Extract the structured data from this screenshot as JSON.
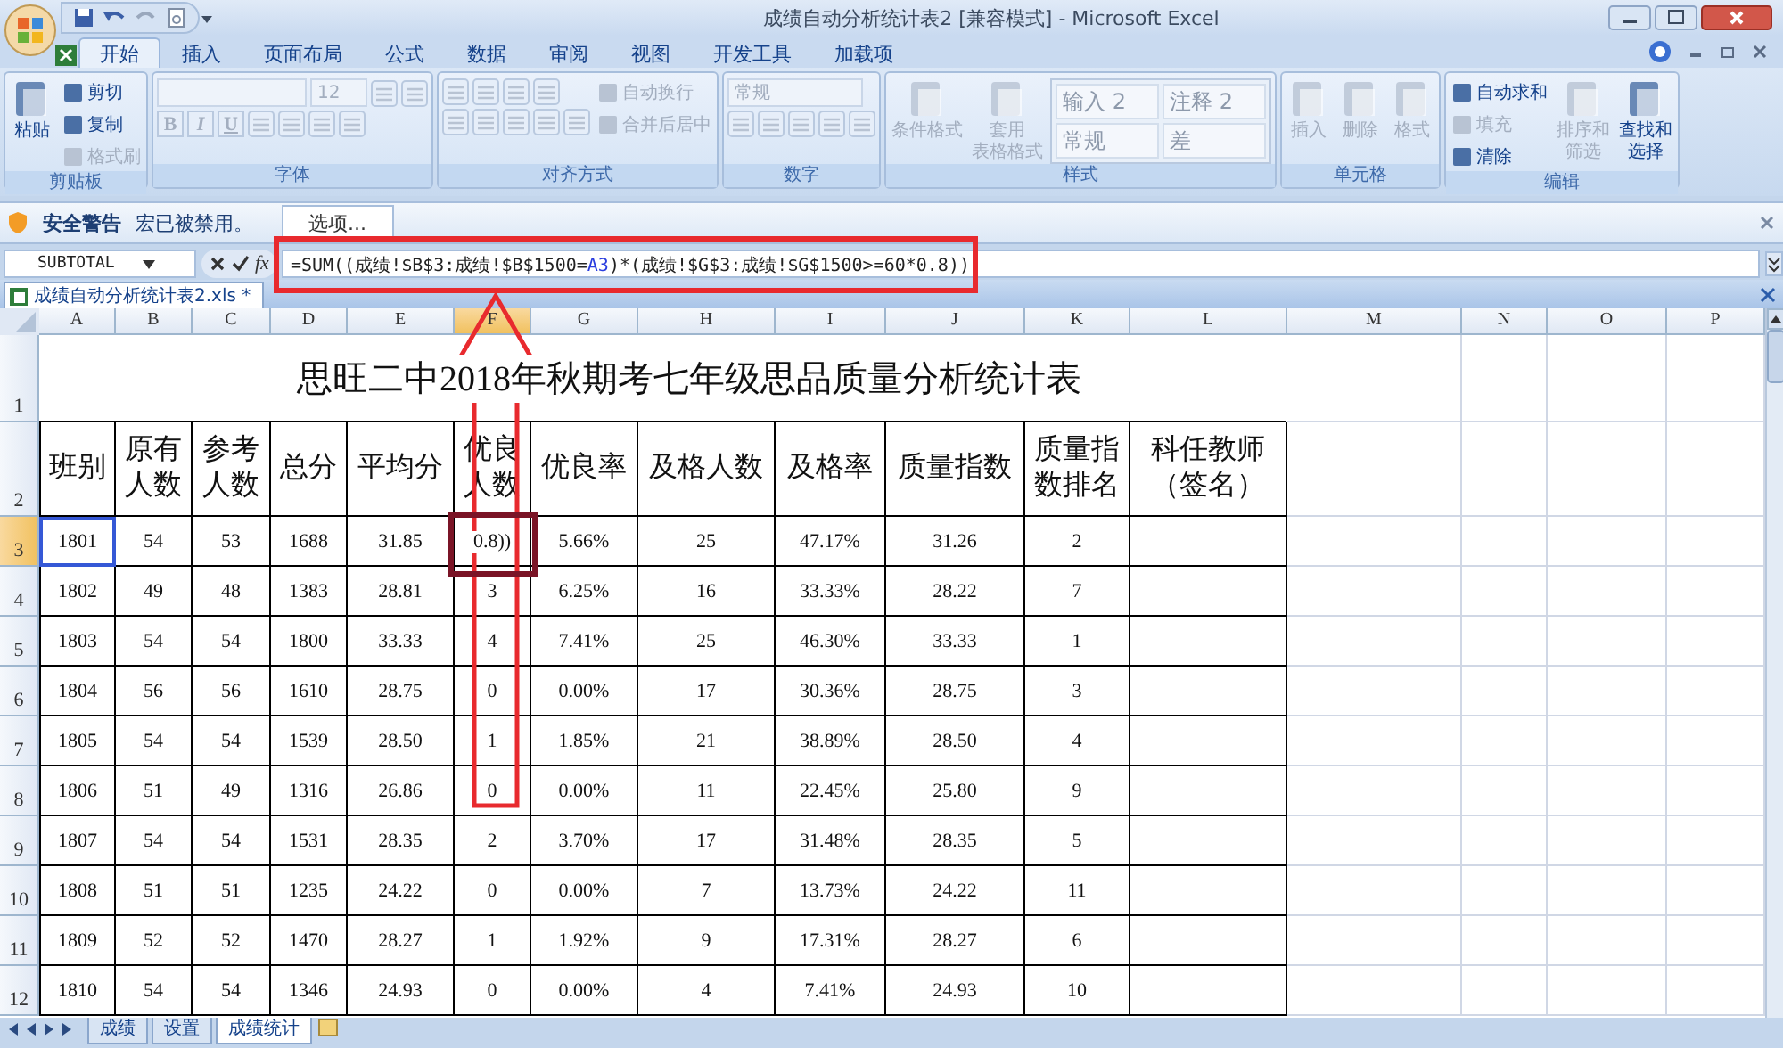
{
  "window": {
    "title": "成绩自动分析统计表2  [兼容模式] - Microsoft Excel"
  },
  "ribbon": {
    "tabs": [
      {
        "label": "开始",
        "selected": true
      },
      {
        "label": "插入",
        "selected": false
      },
      {
        "label": "页面布局",
        "selected": false
      },
      {
        "label": "公式",
        "selected": false
      },
      {
        "label": "数据",
        "selected": false
      },
      {
        "label": "审阅",
        "selected": false
      },
      {
        "label": "视图",
        "selected": false
      },
      {
        "label": "开发工具",
        "selected": false
      },
      {
        "label": "加载项",
        "selected": false
      }
    ],
    "groups": [
      {
        "label": "剪贴板",
        "columns": [
          [
            {
              "kind": "large",
              "label": "粘贴",
              "disabled": false
            }
          ],
          [
            {
              "kind": "small",
              "label": "剪切",
              "disabled": false
            },
            {
              "kind": "small",
              "label": "复制",
              "disabled": false
            },
            {
              "kind": "small",
              "label": "格式刷",
              "disabled": true
            }
          ]
        ]
      },
      {
        "label": "字体",
        "columns": [
          [
            {
              "kind": "toolrow",
              "items": [
                {
                  "kind": "wide_field",
                  "disabled": true
                },
                {
                  "kind": "field",
                  "value": "12",
                  "disabled": true
                },
                {
                  "kind": "icon",
                  "disabled": true
                },
                {
                  "kind": "icon",
                  "disabled": true
                }
              ]
            },
            {
              "kind": "toolrow",
              "items": [
                {
                  "kind": "glyph",
                  "label": "B",
                  "disabled": true
                },
                {
                  "kind": "glyph",
                  "label": "I",
                  "disabled": true
                },
                {
                  "kind": "glyph",
                  "label": "U",
                  "disabled": true
                },
                {
                  "kind": "icon",
                  "disabled": true
                },
                {
                  "kind": "icon",
                  "disabled": true
                },
                {
                  "kind": "icon",
                  "disabled": true
                },
                {
                  "kind": "icon",
                  "disabled": true
                }
              ]
            }
          ]
        ]
      },
      {
        "label": "对齐方式",
        "columns": [
          [
            {
              "kind": "toolrow",
              "items": [
                {
                  "kind": "icon",
                  "disabled": true
                },
                {
                  "kind": "icon",
                  "disabled": true
                },
                {
                  "kind": "icon",
                  "disabled": true
                },
                {
                  "kind": "icon",
                  "disabled": true
                }
              ]
            },
            {
              "kind": "toolrow",
              "items": [
                {
                  "kind": "icon",
                  "disabled": true
                },
                {
                  "kind": "icon",
                  "disabled": true
                },
                {
                  "kind": "icon",
                  "disabled": true
                },
                {
                  "kind": "icon",
                  "disabled": true
                },
                {
                  "kind": "icon",
                  "disabled": true
                }
              ]
            }
          ],
          [
            {
              "kind": "small",
              "label": "自动换行",
              "disabled": true
            },
            {
              "kind": "small",
              "label": "合并后居中",
              "disabled": true
            }
          ]
        ]
      },
      {
        "label": "数字",
        "columns": [
          [
            {
              "kind": "wide_field",
              "value": "常规",
              "disabled": true
            },
            {
              "kind": "toolrow",
              "items": [
                {
                  "kind": "icon",
                  "disabled": true
                },
                {
                  "kind": "icon",
                  "disabled": true
                },
                {
                  "kind": "icon",
                  "disabled": true
                },
                {
                  "kind": "icon",
                  "disabled": true
                },
                {
                  "kind": "icon",
                  "disabled": true
                }
              ]
            }
          ]
        ]
      },
      {
        "label": "样式",
        "columns": [
          [
            {
              "kind": "large",
              "label": "条件格式",
              "disabled": true
            }
          ],
          [
            {
              "kind": "large",
              "lines": [
                "套用",
                "表格格式"
              ],
              "disabled": true
            }
          ],
          [
            {
              "kind": "gallery",
              "cells": [
                "输入 2",
                "注释 2",
                "常规",
                "差"
              ],
              "disabled": true
            }
          ]
        ]
      },
      {
        "label": "单元格",
        "columns": [
          [
            {
              "kind": "large",
              "label": "插入",
              "disabled": true
            }
          ],
          [
            {
              "kind": "large",
              "label": "删除",
              "disabled": true
            }
          ],
          [
            {
              "kind": "large",
              "label": "格式",
              "disabled": true
            }
          ]
        ]
      },
      {
        "label": "编辑",
        "columns": [
          [
            {
              "kind": "small",
              "label": "自动求和",
              "disabled": false
            },
            {
              "kind": "small",
              "label": "填充",
              "disabled": true
            },
            {
              "kind": "small",
              "label": "清除",
              "disabled": false
            }
          ],
          [
            {
              "kind": "large",
              "lines": [
                "排序和",
                "筛选"
              ],
              "disabled": true
            }
          ],
          [
            {
              "kind": "large",
              "lines": [
                "查找和",
                "选择"
              ],
              "disabled": false
            }
          ]
        ]
      }
    ]
  },
  "security_bar": {
    "title": "安全警告",
    "message": "宏已被禁用。",
    "button": "选项..."
  },
  "formula_bar": {
    "name_box": "SUBTOTAL",
    "function_button": "fx",
    "formula": [
      {
        "kind": "text",
        "text": "=SUM(("
      },
      {
        "kind": "text",
        "text": "成绩!$B$3:成绩!$B$1500="
      },
      {
        "kind": "reference",
        "text": "A3"
      },
      {
        "kind": "text",
        "text": ")*("
      },
      {
        "kind": "text",
        "text": "成绩!$G$3:成绩!$G$1500>=60*0.8))"
      }
    ]
  },
  "workbook_tab": {
    "label": "成绩自动分析统计表2.xls *"
  },
  "sheet": {
    "columns": [
      {
        "label": "A",
        "selected": false
      },
      {
        "label": "B",
        "selected": false
      },
      {
        "label": "C",
        "selected": false
      },
      {
        "label": "D",
        "selected": false
      },
      {
        "label": "E",
        "selected": false
      },
      {
        "label": "F",
        "selected": true
      },
      {
        "label": "G",
        "selected": false
      },
      {
        "label": "H",
        "selected": false
      },
      {
        "label": "I",
        "selected": false
      },
      {
        "label": "J",
        "selected": false
      },
      {
        "label": "K",
        "selected": false
      },
      {
        "label": "L",
        "selected": false
      },
      {
        "label": "M",
        "selected": false
      },
      {
        "label": "N",
        "selected": false
      },
      {
        "label": "O",
        "selected": false
      },
      {
        "label": "P",
        "selected": false
      }
    ],
    "title_row": {
      "number": "1",
      "selected": false,
      "title": "思旺二中2018年秋期考七年级思品质量分析统计表"
    },
    "header_row": {
      "number": "2",
      "selected": false,
      "headers": [
        "班别",
        "原有人数",
        "参考人数",
        "总分",
        "平均分",
        "优良人数",
        "优良率",
        "及格人数",
        "及格率",
        "质量指数",
        "质量指数排名",
        "科任教师（签名）"
      ]
    },
    "rows": [
      {
        "number": "3",
        "selected": true,
        "referenced": true,
        "cells": [
          "1801",
          "54",
          "53",
          "1688",
          "31.85",
          "0.8))",
          "5.66%",
          "25",
          "47.17%",
          "31.26",
          "2"
        ]
      },
      {
        "number": "4",
        "selected": false,
        "referenced": false,
        "cells": [
          "1802",
          "49",
          "48",
          "1383",
          "28.81",
          "3",
          "6.25%",
          "16",
          "33.33%",
          "28.22",
          "7"
        ]
      },
      {
        "number": "5",
        "selected": false,
        "referenced": false,
        "cells": [
          "1803",
          "54",
          "54",
          "1800",
          "33.33",
          "4",
          "7.41%",
          "25",
          "46.30%",
          "33.33",
          "1"
        ]
      },
      {
        "number": "6",
        "selected": false,
        "referenced": false,
        "cells": [
          "1804",
          "56",
          "56",
          "1610",
          "28.75",
          "0",
          "0.00%",
          "17",
          "30.36%",
          "28.75",
          "3"
        ]
      },
      {
        "number": "7",
        "selected": false,
        "referenced": false,
        "cells": [
          "1805",
          "54",
          "54",
          "1539",
          "28.50",
          "1",
          "1.85%",
          "21",
          "38.89%",
          "28.50",
          "4"
        ]
      },
      {
        "number": "8",
        "selected": false,
        "referenced": false,
        "cells": [
          "1806",
          "51",
          "49",
          "1316",
          "26.86",
          "0",
          "0.00%",
          "11",
          "22.45%",
          "25.80",
          "9"
        ]
      },
      {
        "number": "9",
        "selected": false,
        "referenced": false,
        "cells": [
          "1807",
          "54",
          "54",
          "1531",
          "28.35",
          "2",
          "3.70%",
          "17",
          "31.48%",
          "28.35",
          "5"
        ]
      },
      {
        "number": "10",
        "selected": false,
        "referenced": false,
        "cells": [
          "1808",
          "51",
          "51",
          "1235",
          "24.22",
          "0",
          "0.00%",
          "7",
          "13.73%",
          "24.22",
          "11"
        ]
      },
      {
        "number": "11",
        "selected": false,
        "referenced": false,
        "cells": [
          "1809",
          "52",
          "52",
          "1470",
          "28.27",
          "1",
          "1.92%",
          "9",
          "17.31%",
          "28.27",
          "6"
        ]
      },
      {
        "number": "12",
        "selected": false,
        "referenced": false,
        "cells": [
          "1810",
          "54",
          "54",
          "1346",
          "24.93",
          "0",
          "0.00%",
          "4",
          "7.41%",
          "24.93",
          "10"
        ]
      }
    ]
  },
  "sheet_tabs": [
    {
      "label": "成绩",
      "selected": false
    },
    {
      "label": "设置",
      "selected": false
    },
    {
      "label": "成绩统计",
      "selected": true
    }
  ]
}
